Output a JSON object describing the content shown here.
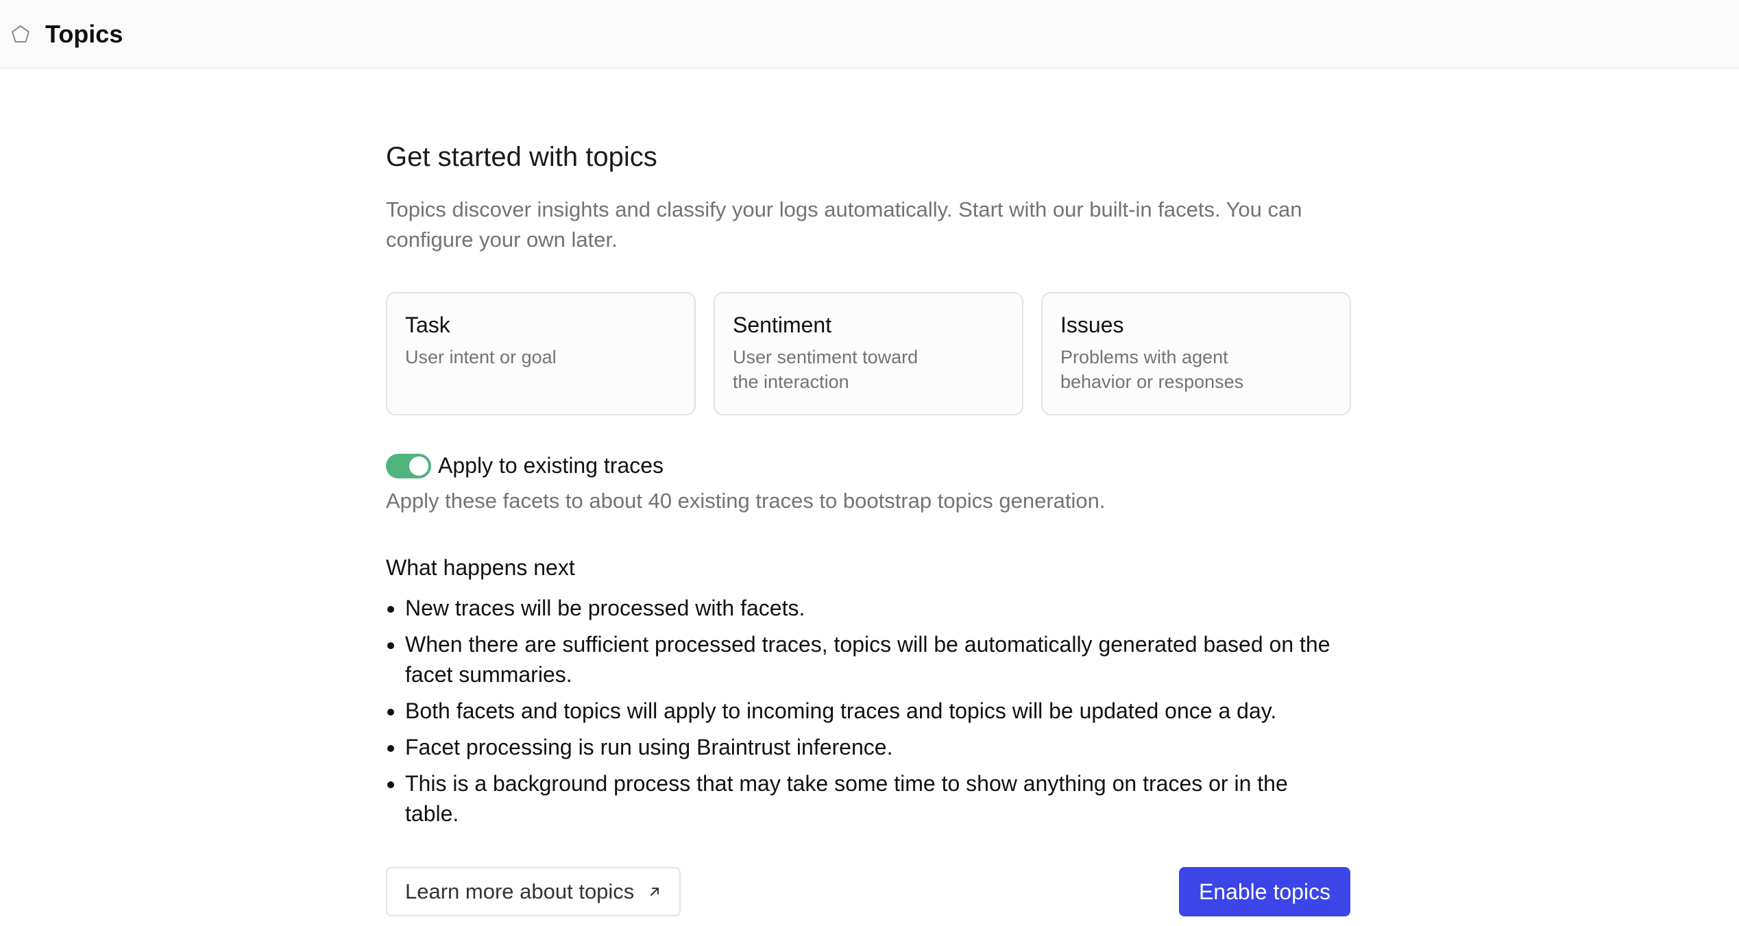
{
  "header": {
    "icon": "pentagon-icon",
    "title": "Topics"
  },
  "main": {
    "heading": "Get started with topics",
    "intro": "Topics discover insights and classify your logs automatically. Start with our built-in facets. You can configure your own later.",
    "facets": [
      {
        "name": "Task",
        "description": "User intent or goal"
      },
      {
        "name": "Sentiment",
        "description": "User sentiment toward the interaction"
      },
      {
        "name": "Issues",
        "description": "Problems with agent behavior or responses"
      }
    ],
    "apply_toggle": {
      "label": "Apply to existing traces",
      "checked": true,
      "color": "#4fb47e",
      "description": "Apply these facets to about 40 existing traces to bootstrap topics generation."
    },
    "next": {
      "heading": "What happens next",
      "items": [
        "New traces will be processed with facets.",
        "When there are sufficient processed traces, topics will be automatically generated based on the facet summaries.",
        "Both facets and topics will apply to incoming traces and topics will be updated once a day.",
        "Facet processing is run using Braintrust inference.",
        "This is a background process that may take some time to show anything on traces or in the table."
      ]
    },
    "learn_more_label": "Learn more about topics",
    "learn_more_icon": "external-arrow-icon",
    "enable_label": "Enable topics",
    "accent_color": "#3b45e8"
  }
}
